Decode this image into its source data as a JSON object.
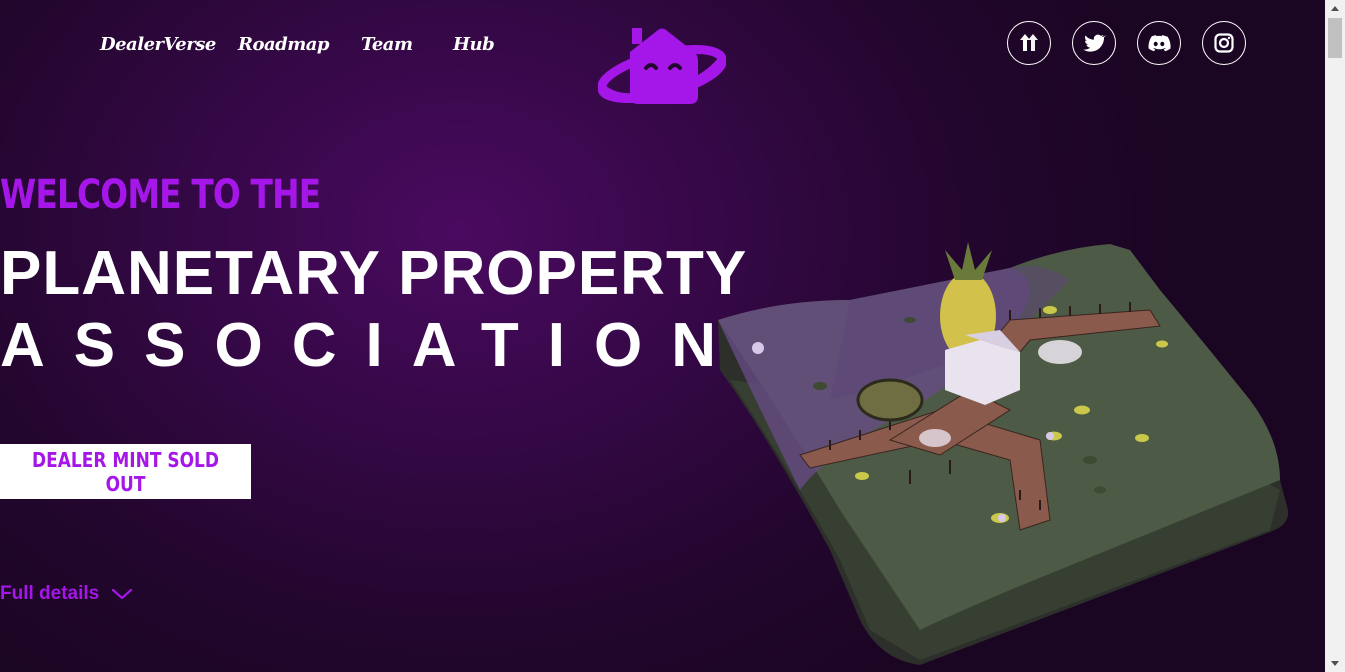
{
  "nav": {
    "links": [
      "DealerVerse",
      "Roadmap",
      "Team",
      "Hub"
    ]
  },
  "social": [
    "linktree-icon",
    "twitter-icon",
    "discord-icon",
    "instagram-icon"
  ],
  "hero": {
    "welcome": "WELCOME TO THE",
    "title_line1": "PLANETARY PROPERTY",
    "title_line2": "ASSOCIATION",
    "mint_button": "DEALER MINT SOLD OUT",
    "details_link": "Full details"
  },
  "colors": {
    "accent": "#a516e8",
    "background": "#23062e",
    "text": "#ffffff"
  }
}
